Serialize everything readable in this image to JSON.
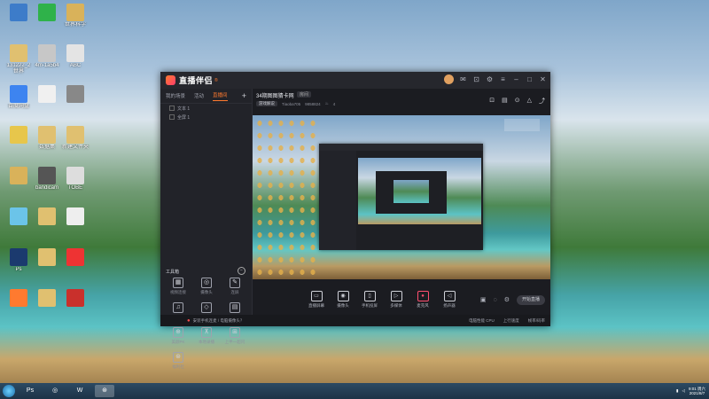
{
  "desktop_icons": [
    {
      "label": "",
      "color": "#3d7cc9"
    },
    {
      "label": "",
      "color": "#2fb24a"
    },
    {
      "label": "世界科学",
      "color": "#d9b25a"
    },
    {
      "label": "131222_2\n世界",
      "color": "#e0c070"
    },
    {
      "label": "4m-1a5b4",
      "color": "#c7c7c7"
    },
    {
      "label": "ABC",
      "color": "#e4e4e4"
    },
    {
      "label": "百度网盘",
      "color": "#3d84f0"
    },
    {
      "label": "",
      "color": "#f0f0f0"
    },
    {
      "label": "",
      "color": "#888"
    },
    {
      "label": "",
      "color": "#e7c64b"
    },
    {
      "label": "数据集",
      "color": "#e0c070"
    },
    {
      "label": "新建文件夹",
      "color": "#e0c070"
    },
    {
      "label": "",
      "color": "#d9b25a"
    },
    {
      "label": "bandicam",
      "color": "#555"
    },
    {
      "label": "TOBE",
      "color": "#ddd"
    },
    {
      "label": "",
      "color": "#6bc4e9"
    },
    {
      "label": "",
      "color": "#e0c070"
    },
    {
      "label": "",
      "color": "#eee"
    },
    {
      "label": "Ps",
      "color": "#1b3a6e"
    },
    {
      "label": "",
      "color": "#e0c070"
    },
    {
      "label": "",
      "color": "#e33"
    },
    {
      "label": "",
      "color": "#ff7a2f"
    },
    {
      "label": "",
      "color": "#e0c070"
    },
    {
      "label": "",
      "color": "#c9302c"
    }
  ],
  "window": {
    "app_name": "直播伴侣",
    "badge": "®"
  },
  "left_panel": {
    "tabs": [
      "我的场景",
      "活动",
      "直播间"
    ],
    "active_tab": 2,
    "scenes": [
      "文本 1",
      "全屏 1"
    ],
    "tools_title": "工具箱",
    "tools": [
      {
        "icon": "▦",
        "label": "视频连接"
      },
      {
        "icon": "◎",
        "label": "摄像头"
      },
      {
        "icon": "✎",
        "label": "连屏"
      },
      {
        "icon": "♫",
        "label": "音乐"
      },
      {
        "icon": "◇",
        "label": "弹幕"
      },
      {
        "icon": "▤",
        "label": "歌词助手"
      },
      {
        "icon": "⊕",
        "label": "美颜PK"
      },
      {
        "icon": "⊼",
        "label": "本地录播"
      },
      {
        "icon": "⊞",
        "label": "上半一超闪"
      },
      {
        "icon": "⊛",
        "label": "福利社"
      }
    ]
  },
  "room": {
    "title": "34期图图猜卡网",
    "tag": "房间",
    "category_btn": "游戏解说",
    "line1": "Tiaoba705",
    "line2": "9858824",
    "heat": "4"
  },
  "controls": [
    {
      "icon": "▭",
      "label": "直播屏幕"
    },
    {
      "icon": "◉",
      "label": "摄像头"
    },
    {
      "icon": "▯",
      "label": "手机投屏"
    },
    {
      "icon": "▷",
      "label": "多媒体"
    },
    {
      "icon": "●",
      "label": "麦克风",
      "mic": true
    },
    {
      "icon": "◁",
      "label": "扬声器"
    }
  ],
  "go_live": "开始直播",
  "status": {
    "warning": "安装手机连麦 / 电脑摄像头？",
    "stats": [
      "电脑性能 CPU",
      "上行速度",
      "帧率/码率"
    ]
  },
  "taskbar": {
    "apps": [
      "Ps",
      "◎",
      "W",
      "⊛"
    ],
    "clock_time": "9:01 周六",
    "clock_date": "2021/8/7"
  }
}
